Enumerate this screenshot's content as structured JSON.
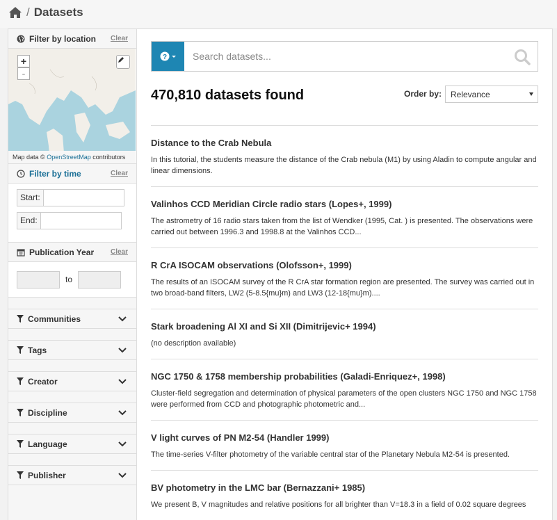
{
  "breadcrumb": {
    "separator": "/",
    "current": "Datasets"
  },
  "sidebar": {
    "location": {
      "title": "Filter by location",
      "clear": "Clear",
      "attribution_prefix": "Map data ©",
      "attribution_link": "OpenStreetMap",
      "attribution_suffix": "contributors",
      "zoom_in": "+",
      "zoom_out": "-"
    },
    "time": {
      "title": "Filter by time",
      "clear": "Clear",
      "start_label": "Start:",
      "end_label": "End:",
      "start_value": "",
      "end_value": ""
    },
    "year": {
      "title": "Publication Year",
      "clear": "Clear",
      "to": "to"
    },
    "facets": [
      {
        "label": "Communities"
      },
      {
        "label": "Tags"
      },
      {
        "label": "Creator"
      },
      {
        "label": "Discipline"
      },
      {
        "label": "Language"
      },
      {
        "label": "Publisher"
      }
    ]
  },
  "search": {
    "placeholder": "Search datasets..."
  },
  "results_header": {
    "count": "470,810 datasets found",
    "order_label": "Order by:",
    "order_value": "Relevance"
  },
  "results": [
    {
      "title": "Distance to the Crab Nebula",
      "desc": "In this tutorial, the students measure the distance of the Crab nebula (M1) by using Aladin to compute angular and linear dimensions."
    },
    {
      "title": "Valinhos CCD Meridian Circle radio stars (Lopes+, 1999)",
      "desc": "The astrometry of 16 radio stars taken from the list of Wendker (1995, Cat. ) is presented. The observations were carried out between 1996.3 and 1998.8 at the Valinhos CCD..."
    },
    {
      "title": "R CrA ISOCAM observations (Olofsson+, 1999)",
      "desc": "The results of an ISOCAM survey of the R CrA star formation region are presented. The survey was carried out in two broad-band filters, LW2 (5-8.5{mu}m) and LW3 (12-18{mu}m)...."
    },
    {
      "title": "Stark broadening Al XI and Si XII (Dimitrijevic+ 1994)",
      "desc": "(no description available)"
    },
    {
      "title": "NGC 1750 & 1758 membership probabilities (Galadi-Enriquez+, 1998)",
      "desc": "Cluster-field segregation and determination of physical parameters of the open clusters NGC 1750 and NGC 1758 were performed from CCD and photographic photometric and..."
    },
    {
      "title": "V light curves of PN M2-54 (Handler 1999)",
      "desc": "The time-series V-filter photometry of the variable central star of the Planetary Nebula M2-54 is presented."
    },
    {
      "title": "BV photometry in the LMC bar (Bernazzani+ 1985)",
      "desc": "We present B, V magnitudes and relative positions for all brighter than V=18.3 in a field of 0.02 square degrees"
    }
  ]
}
